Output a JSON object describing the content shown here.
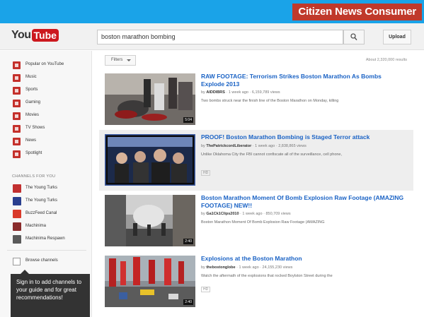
{
  "banner": {
    "label": "Citizen News Consumer"
  },
  "header": {
    "logo_you": "You",
    "logo_tube": "Tube",
    "search_query": "boston marathon bombing",
    "upload_label": "Upload"
  },
  "sidebar": {
    "items": [
      {
        "label": "Popular on YouTube"
      },
      {
        "label": "Music"
      },
      {
        "label": "Sports"
      },
      {
        "label": "Gaming"
      },
      {
        "label": "Movies"
      },
      {
        "label": "TV Shows"
      },
      {
        "label": "News"
      },
      {
        "label": "Spotlight"
      }
    ],
    "section_title": "CHANNELS FOR YOU",
    "channels": [
      {
        "label": "The Young Turks"
      },
      {
        "label": "The Young Turks"
      },
      {
        "label": "BuzzFeed Canal"
      },
      {
        "label": "Machinima"
      },
      {
        "label": "Machinima Respawn"
      }
    ],
    "browse_label": "Browse channels",
    "signin_tip": "Sign in to add channels to your guide and for great recommendations!"
  },
  "main": {
    "filters_label": "Filters",
    "results_count": "About 2,320,000 results",
    "results": [
      {
        "title": "RAW FOOTAGE: Terrorism Strikes Boston Marathon As Bombs Explode 2013",
        "channel": "AIDDIBRS",
        "age": "1 week ago",
        "views": "6,159,789 views",
        "description": "Two bombs struck near the finish line of the Boston Marathon on Monday, killing",
        "duration": "5:04"
      },
      {
        "title": "PROOF! Boston Marathon Bombing is Staged Terror attack",
        "channel": "ThePatrickcordLiberator",
        "age": "1 week ago",
        "views": "2,838,865 views",
        "description": "Unlike Oklahoma City the FBI cannot confiscate all of the surveillance, cell phone,",
        "hd": "HD",
        "duration": ""
      },
      {
        "title": "Boston Marathon Moment Of Bomb Explosion Raw Footage (AMAZING FOOTAGE) NEW!!",
        "channel": "Ga1Ck1Clips2010",
        "age": "1 week ago",
        "views": "850,709 views",
        "description": "Boston Marathon Moment Of Bomb Explosion Raw Footage (AMAZING",
        "duration": "2:40"
      },
      {
        "title": "Explosions at the Boston Marathon",
        "channel": "thebostonglobe",
        "age": "1 week ago",
        "views": "24,155,230 views",
        "description": "Watch the aftermath of the explosions that rocked Boylston Street during the",
        "hd": "HD",
        "duration": "2:40"
      }
    ]
  }
}
